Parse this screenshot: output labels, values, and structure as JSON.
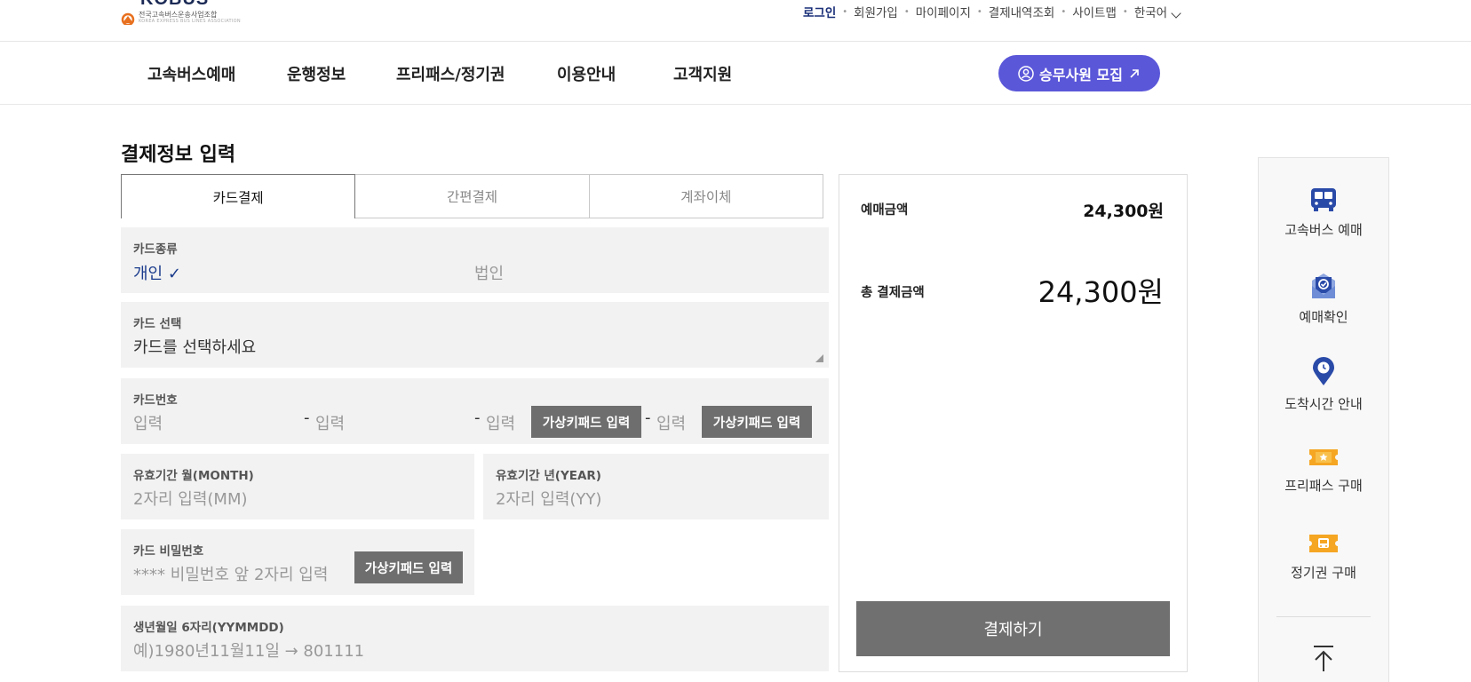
{
  "colors": {
    "brand_navy": "#1a2f78",
    "recruit_purple": "#5b57d9",
    "button_gray": "#6e6e6e",
    "field_bg": "#f2f2f2",
    "logo_orange": "#e8701e"
  },
  "header": {
    "logo_text": "KOBUS",
    "logo_subtitle": "전국고속버스운송사업조합",
    "logo_subtitle_en": "KOREA EXPRESS BUS LINES ASSOCIATION",
    "util": {
      "login": "로그인",
      "signup": "회원가입",
      "mypage": "마이페이지",
      "payment_history": "결제내역조회",
      "sitemap": "사이트맵",
      "language": "한국어"
    },
    "nav": [
      "고속버스예매",
      "운행정보",
      "프리패스/정기권",
      "이용안내",
      "고객지원"
    ],
    "recruit_label": "승무사원 모집"
  },
  "page": {
    "title": "결제정보 입력",
    "tabs": [
      "카드결제",
      "간편결제",
      "계좌이체"
    ],
    "form": {
      "card_type": {
        "label": "카드종류",
        "options": [
          "개인",
          "법인"
        ],
        "selected": "개인",
        "check": "✓"
      },
      "card_select": {
        "label": "카드 선택",
        "value": "카드를 선택하세요"
      },
      "card_number": {
        "label": "카드번호",
        "placeholder": "입력",
        "dash": "-",
        "virtual_keypad": "가상키패드 입력"
      },
      "exp_month": {
        "label": "유효기간 월(MONTH)",
        "placeholder": "2자리 입력(MM)"
      },
      "exp_year": {
        "label": "유효기간 년(YEAR)",
        "placeholder": "2자리 입력(YY)"
      },
      "card_password": {
        "label": "카드 비밀번호",
        "placeholder": "**** 비밀번호 앞 2자리 입력",
        "virtual_keypad": "가상키패드 입력"
      },
      "birth": {
        "label": "생년월일 6자리(YYMMDD)",
        "placeholder": "예)1980년11월11일 → 801111"
      }
    },
    "summary": {
      "ticket_amount_label": "예매금액",
      "ticket_amount": "24,300원",
      "total_label": "총 결제금액",
      "total_amount": "24,300원",
      "pay_button": "결제하기"
    }
  },
  "quick_menu": {
    "items": [
      {
        "label": "고속버스 예매",
        "icon": "bus-icon"
      },
      {
        "label": "예매확인",
        "icon": "ticket-check-icon"
      },
      {
        "label": "도착시간 안내",
        "icon": "location-clock-icon"
      },
      {
        "label": "프리패스 구매",
        "icon": "freepass-icon"
      },
      {
        "label": "정기권 구매",
        "icon": "season-ticket-icon"
      }
    ],
    "top_icon": "arrow-up-top-icon"
  }
}
